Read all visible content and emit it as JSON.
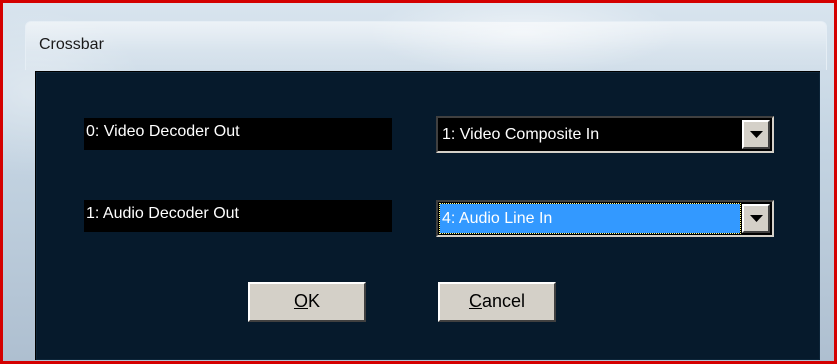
{
  "window": {
    "title": "Crossbar"
  },
  "rows": [
    {
      "output_label": "0: Video Decoder Out",
      "input_value": "1: Video Composite In"
    },
    {
      "output_label": "1: Audio Decoder Out",
      "input_value": "4: Audio Line In"
    }
  ],
  "buttons": {
    "ok": {
      "mnemonic": "O",
      "rest": "K"
    },
    "cancel": {
      "mnemonic": "C",
      "rest": "ancel"
    }
  },
  "colors": {
    "frame_border": "#d40000",
    "client_background": "#061a2c",
    "selection": "#3399ff"
  }
}
